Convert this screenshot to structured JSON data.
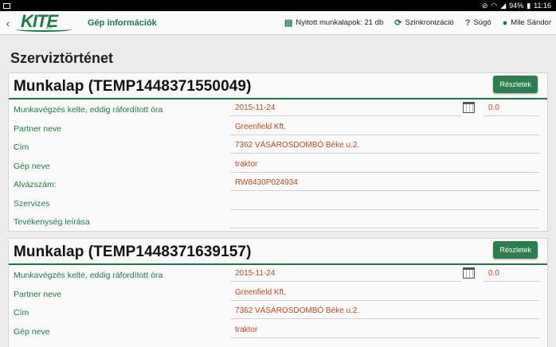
{
  "statusbar": {
    "battery": "94%",
    "time": "11:16"
  },
  "header": {
    "logo_text": "KITE",
    "logo_sub": "Zrt.",
    "title": "Gép információk",
    "actions": [
      {
        "label": "Nyitott munkalapok: 21 db",
        "icon": "clipboard-icon"
      },
      {
        "label": "Szinkronizáció",
        "icon": "sync-icon"
      },
      {
        "label": "Súgó",
        "icon": "help-icon"
      },
      {
        "label": "Mile Sándor",
        "icon": "user-icon"
      }
    ]
  },
  "page_title": "Szerviztörténet",
  "details_label": "Részletek",
  "cards": [
    {
      "title": "Munkalap (TEMP1448371550049)",
      "fields": {
        "date_label": "Munkavégzés kelte, eddig ráfordított óra",
        "date": "2015-11-24",
        "hours": "0.0",
        "partner_label": "Partner neve",
        "partner": "Greenfield Kft.",
        "address_label": "Cím",
        "address": "7362 VÁSÁROSDOMBÓ Béke u.2.",
        "machine_label": "Gép neve",
        "machine": "traktor",
        "chassis_label": "Alvázszám:",
        "chassis": "RW8430P024934",
        "technician_label": "Szervizes",
        "technician": "",
        "activity_label": "Tevékenység leírása",
        "activity": ""
      }
    },
    {
      "title": "Munkalap (TEMP1448371639157)",
      "fields": {
        "date_label": "Munkavégzés kelte, eddig ráfordított óra",
        "date": "2015-11-24",
        "hours": "0.0",
        "partner_label": "Partner neve",
        "partner": "Greenfield Kft.",
        "address_label": "Cím",
        "address": "7362 VÁSÁROSDOMBÓ Béke u.2.",
        "machine_label": "Gép neve",
        "machine": "traktor"
      }
    }
  ]
}
